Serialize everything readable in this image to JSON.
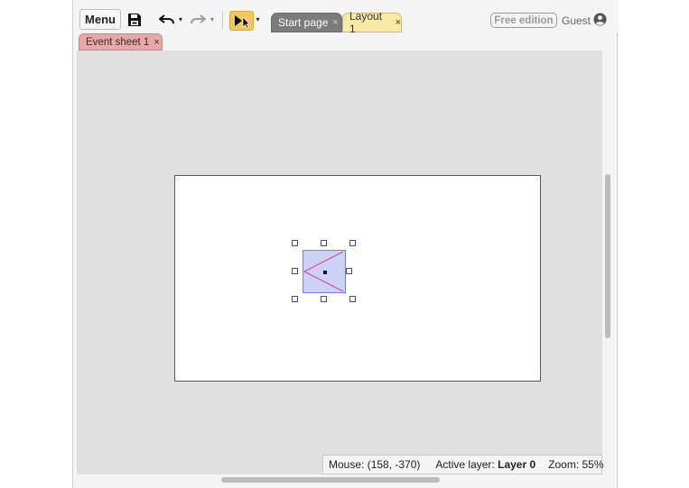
{
  "toolbar": {
    "menu_label": "Menu",
    "icons": {
      "save": "save-icon",
      "undo": "undo-icon",
      "redo": "redo-icon",
      "select": "select-pointer-icon",
      "dropdown": "chevron-down-icon"
    }
  },
  "tabs": [
    {
      "label": "Start page",
      "close": "×",
      "active": false
    },
    {
      "label": "Layout 1",
      "close": "×",
      "active": true
    }
  ],
  "subtabs": [
    {
      "label": "Event sheet 1",
      "close": "×"
    }
  ],
  "account": {
    "edition": "Free edition",
    "user": "Guest",
    "avatar_icon": "user-circle-icon"
  },
  "status": {
    "mouse_label": "Mouse:",
    "mouse_value": "(158, -370)",
    "layer_label": "Active layer:",
    "layer_value": "Layer 0",
    "zoom_label": "Zoom:",
    "zoom_value": "55%"
  },
  "colors": {
    "select_accent": "#f3c760",
    "layout_tab": "#f8e9a8",
    "event_tab": "#e8a7a9",
    "sprite_fill": "#cdd0f7",
    "sprite_line": "#d0508a"
  }
}
